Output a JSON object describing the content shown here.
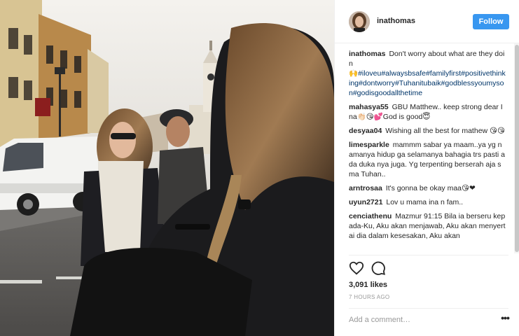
{
  "post": {
    "username": "inathomas",
    "follow_label": "Follow"
  },
  "caption": {
    "username": "inathomas",
    "text": "Don't worry about what are they doin",
    "hashtags": "🙌#iloveu#alwaysbsafe#familyfirst#positivethinking#dontworry#Tuhanitubaik#godblessyoumyson#godisgoodallthetime"
  },
  "comments": [
    {
      "username": "mahasya55",
      "text": "GBU Matthew.. keep strong dear Ina👏🏻😘💕God is good😇"
    },
    {
      "username": "desyaa04",
      "text": "Wishing all the best for mathew 😘😘"
    },
    {
      "username": "limesparkle",
      "text": "mammm sabar ya maam..ya yg namanya hidup ga selamanya bahagia trs pasti ada duka nya juga. Yg terpenting berserah aja sma Tuhan.."
    },
    {
      "username": "arntrosaa",
      "text": "It's gonna be okay maa😘❤"
    },
    {
      "username": "uyun2721",
      "text": "Lov u mama ina n fam.."
    },
    {
      "username": "cenciathenu",
      "text": "Mazmur 91:15 Bila ia berseru kepada-Ku, Aku akan menjawab, Aku akan menyertai dia dalam kesesakan, Aku akan"
    }
  ],
  "actions": {
    "likes": "3,091 likes",
    "time": "7 HOURS AGO",
    "comment_placeholder": "Add a comment…",
    "more_label": "•••"
  },
  "icons": {
    "like": "heart-icon",
    "comment": "speech-bubble-icon",
    "more": "ellipsis-icon"
  },
  "colors": {
    "follow": "#3897f0",
    "hashtag": "#003569"
  }
}
